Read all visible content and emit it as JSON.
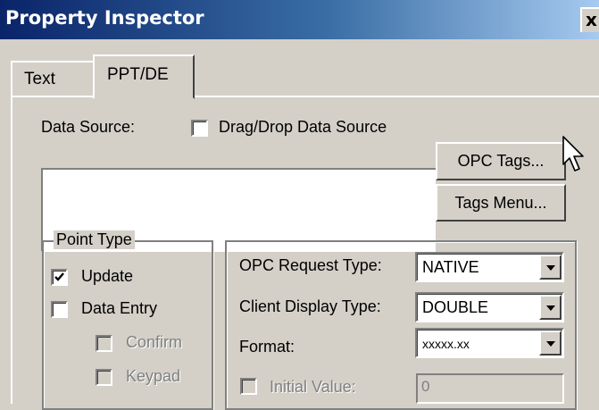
{
  "window": {
    "title": "Property Inspector",
    "close_glyph": "x"
  },
  "tabs": [
    {
      "label": "Text",
      "selected": false
    },
    {
      "label": "PPT/DE",
      "selected": true
    }
  ],
  "data_source": {
    "label": "Data Source:",
    "drag_drop_label": "Drag/Drop Data Source",
    "drag_drop_checked": false,
    "value": "",
    "opc_tags_button": "OPC Tags...",
    "tags_menu_button": "Tags Menu..."
  },
  "point_type": {
    "legend": "Point Type",
    "items": [
      {
        "label": "Update",
        "checked": true,
        "enabled": true
      },
      {
        "label": "Data Entry",
        "checked": false,
        "enabled": true
      },
      {
        "label": "Confirm",
        "checked": false,
        "enabled": false
      },
      {
        "label": "Keypad",
        "checked": false,
        "enabled": false
      }
    ]
  },
  "settings": {
    "opc_request_type": {
      "label": "OPC Request Type:",
      "value": "NATIVE"
    },
    "client_display_type": {
      "label": "Client Display Type:",
      "value": "DOUBLE"
    },
    "format": {
      "label": "Format:",
      "value": "xxxxx.xx"
    },
    "initial_value": {
      "label": "Initial Value:",
      "value": "0",
      "checked": false,
      "enabled": false
    }
  },
  "icons": {
    "check": "check-mark",
    "dropdown": "chevron-down-icon",
    "cursor": "mouse-pointer-icon"
  }
}
